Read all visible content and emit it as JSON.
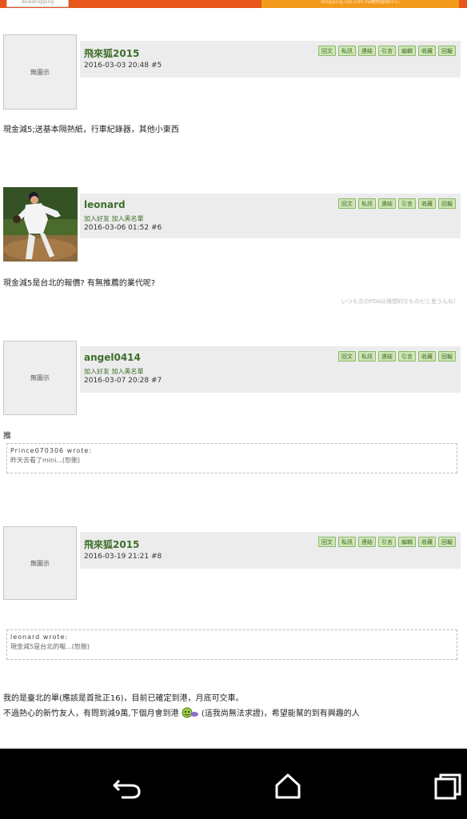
{
  "banner": {
    "logo_text": "dealshopping",
    "right_text": "shopping.cat.com.tw購物服務中心"
  },
  "buttons": {
    "reply": "回文",
    "pm": "私訊",
    "link": "連結",
    "quote": "引言",
    "edit": "編輯",
    "fav": "收藏",
    "report": "回報"
  },
  "posts": [
    {
      "username": "飛來狐2015",
      "avatar_text": "無圖示",
      "datetime": "2016-03-03 20:48",
      "floor": "#5",
      "content": "現金減5;送基本隔熱紙，行車紀錄器，其他小東西"
    },
    {
      "username": "leonard",
      "add_friend": "加入好友",
      "add_blacklist": "加入黑名單",
      "datetime": "2016-03-06 01:52",
      "floor": "#6",
      "content": "現金減5是台北的報價? 有無推薦的業代呢?",
      "signature": "いつも次のPDAは理想的なものだと思うんね！"
    },
    {
      "username": "angel0414",
      "avatar_text": "無圖示",
      "add_friend": "加入好友",
      "add_blacklist": "加入黑名單",
      "datetime": "2016-03-07 20:28",
      "floor": "#7",
      "content": "推",
      "quote_author": "Prince070306 wrote:",
      "quote_text": "昨天去看了mini...(恕刪)"
    },
    {
      "username": "飛來狐2015",
      "avatar_text": "無圖示",
      "datetime": "2016-03-19 21:21",
      "floor": "#8",
      "quote_author": "leonard wrote:",
      "quote_text": "現金減5是台北的報...(恕刪)",
      "content_line1": "我的是臺北的單(應該是首批正16)，目前已確定到港，月底可交車。",
      "content_line2a": "不過熱心的新竹友人，有問到減9萬,下個月會到港",
      "content_line2b": "(這我尚無法求證)，希望能幫的到有興趣的人"
    }
  ],
  "navbar": {
    "back_icon": "back-icon",
    "home_icon": "home-icon",
    "recents_icon": "recents-icon"
  }
}
